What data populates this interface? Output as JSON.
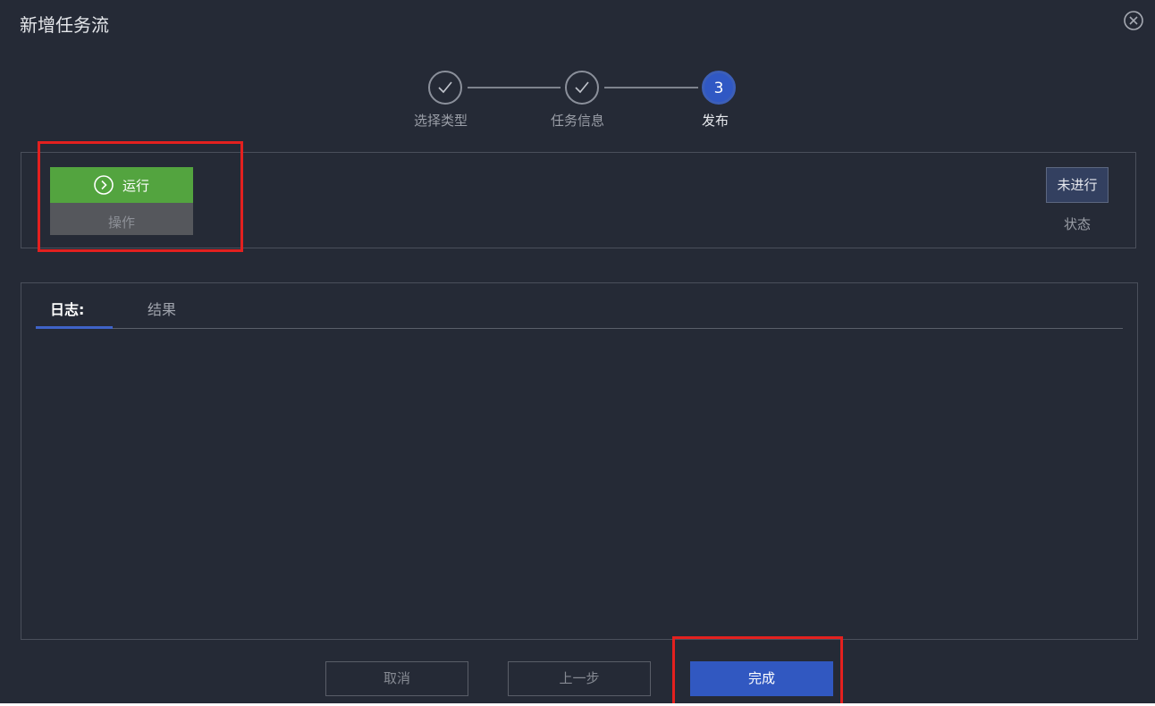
{
  "dialog": {
    "title": "新增任务流"
  },
  "stepper": {
    "steps": [
      {
        "label": "选择类型",
        "state": "done"
      },
      {
        "label": "任务信息",
        "state": "done"
      },
      {
        "label": "发布",
        "state": "active",
        "number": "3"
      }
    ]
  },
  "operation": {
    "run_label": "运行",
    "op_label": "操作",
    "status_value": "未进行",
    "status_label": "状态"
  },
  "log": {
    "tabs": [
      {
        "label": "日志:",
        "active": true
      },
      {
        "label": "结果",
        "active": false
      }
    ],
    "content": ""
  },
  "footer": {
    "cancel_label": "取消",
    "prev_label": "上一步",
    "finish_label": "完成"
  },
  "colors": {
    "background": "#252a36",
    "run_green": "#53a43f",
    "primary_blue": "#3158c1",
    "highlight_red": "#e3201f"
  }
}
